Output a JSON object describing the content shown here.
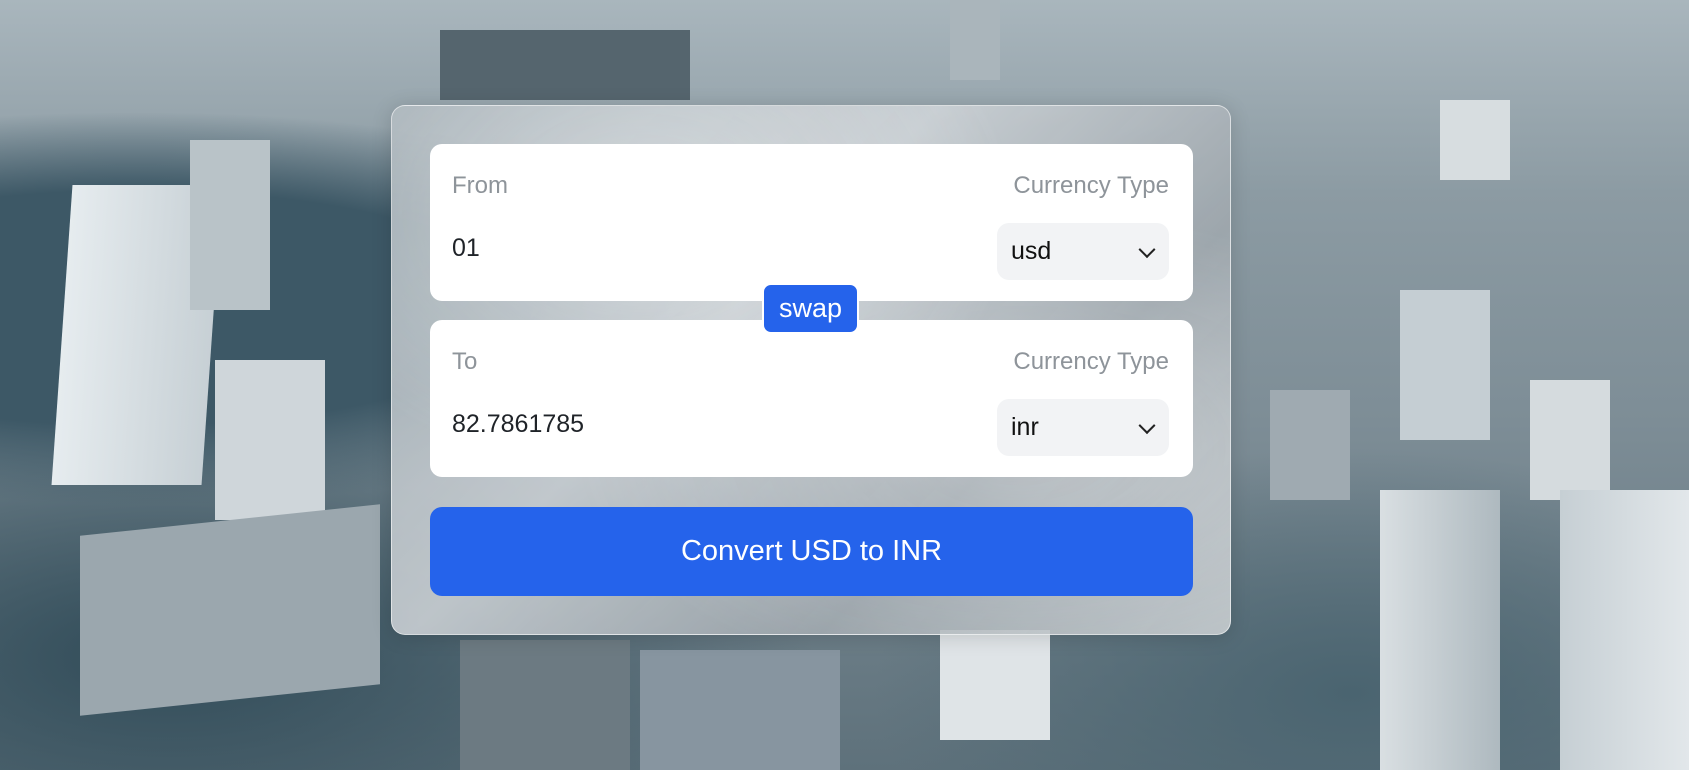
{
  "from": {
    "label": "From",
    "currency_label": "Currency Type",
    "amount": "01",
    "currency": "usd"
  },
  "to": {
    "label": "To",
    "currency_label": "Currency Type",
    "amount": "82.7861785",
    "currency": "inr"
  },
  "swap_label": "swap",
  "convert_label": "Convert USD to INR",
  "colors": {
    "accent": "#2563eb",
    "card": "#ffffff",
    "select_bg": "#f2f3f5"
  }
}
